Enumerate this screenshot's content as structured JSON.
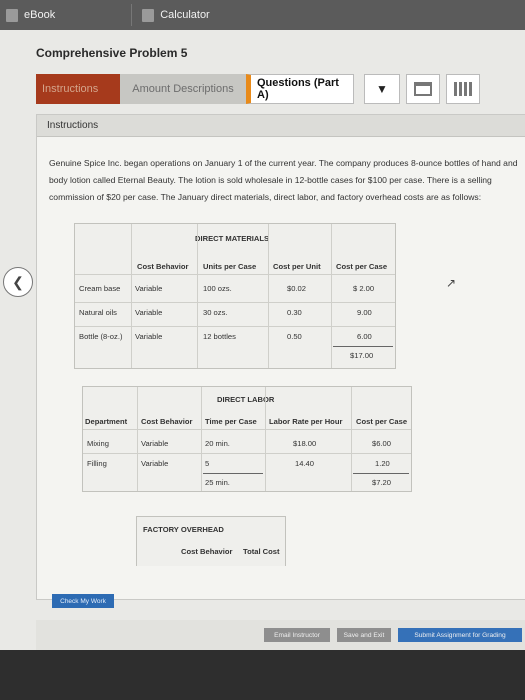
{
  "topbar": {
    "ebook": "eBook",
    "calculator": "Calculator"
  },
  "page_title": "Comprehensive Problem 5",
  "tabs": {
    "instructions": "Instructions",
    "amount": "Amount Descriptions",
    "questions": "Questions (Part A)",
    "dropdown": "▼"
  },
  "instructions_header": "Instructions",
  "paragraph": "Genuine Spice Inc. began operations on January 1 of the current year. The company produces 8-ounce bottles of hand and body lotion called Eternal Beauty. The lotion is sold wholesale in 12-bottle cases for $100 per case. There is a selling commission of $20 per case. The January direct materials, direct labor, and factory overhead costs are as follows:",
  "direct_materials": {
    "title": "DIRECT MATERIALS",
    "headers": [
      "Cost Behavior",
      "Units per Case",
      "Cost per Unit",
      "Cost per Case"
    ],
    "rows": [
      {
        "name": "Cream base",
        "behavior": "Variable",
        "units": "100 ozs.",
        "unit_cost": "$0.02",
        "case_cost": "$ 2.00"
      },
      {
        "name": "Natural oils",
        "behavior": "Variable",
        "units": "30 ozs.",
        "unit_cost": "0.30",
        "case_cost": "9.00"
      },
      {
        "name": "Bottle (8-oz.)",
        "behavior": "Variable",
        "units": "12 bottles",
        "unit_cost": "0.50",
        "case_cost": "6.00"
      }
    ],
    "total": "$17.00"
  },
  "direct_labor": {
    "title": "DIRECT LABOR",
    "headers": [
      "Department",
      "Cost Behavior",
      "Time per Case",
      "Labor Rate per Hour",
      "Cost per Case"
    ],
    "rows": [
      {
        "dept": "Mixing",
        "behavior": "Variable",
        "time": "20 min.",
        "rate": "$18.00",
        "cost": "$6.00"
      },
      {
        "dept": "Filling",
        "behavior": "Variable",
        "time": "5",
        "rate": "14.40",
        "cost": "1.20"
      }
    ],
    "total_time": "25 min.",
    "total_cost": "$7.20"
  },
  "factory_overhead": {
    "title": "FACTORY OVERHEAD",
    "headers": [
      "Cost Behavior",
      "Total Cost"
    ]
  },
  "buttons": {
    "check": "Check My Work",
    "email": "Email Instructor",
    "save": "Save and Exit",
    "submit": "Submit Assignment for Grading"
  },
  "icons": {
    "back": "chevron-left-icon",
    "cursor": "mouse-cursor-icon"
  },
  "colors": {
    "instructions_tab": "#a63a1c",
    "questions_accent": "#e88a1a",
    "primary_button": "#3571b8"
  }
}
